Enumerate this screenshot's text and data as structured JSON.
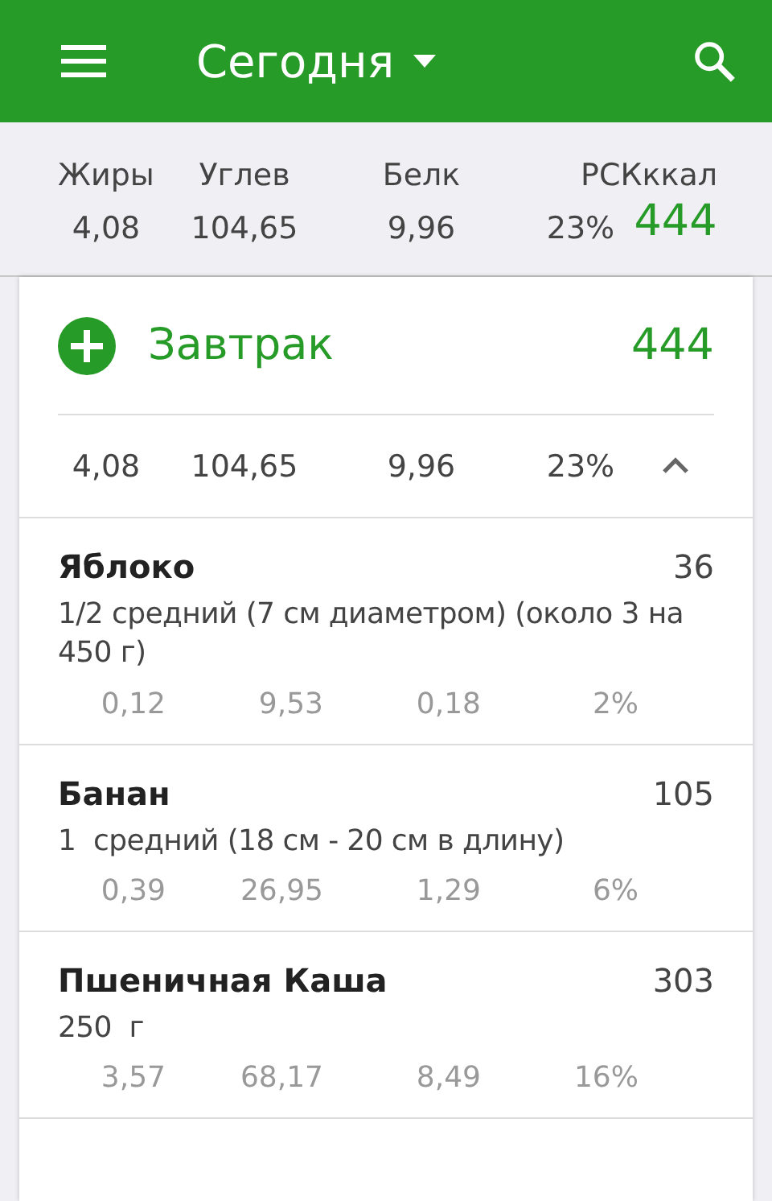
{
  "app_bar": {
    "title": "Сегодня"
  },
  "summary": {
    "labels": [
      "Жиры",
      "Углев",
      "Белк",
      "РСКккал"
    ],
    "values": [
      "4,08",
      "104,65",
      "9,96",
      "23%"
    ],
    "calories": "444"
  },
  "meal": {
    "name": "Завтрак",
    "calories": "444",
    "totals": [
      "4,08",
      "104,65",
      "9,96",
      "23%"
    ],
    "expanded": true,
    "items": [
      {
        "name": "Яблоко",
        "calories": "36",
        "portion": "1/2 средний (7 см диаметром) (около 3 на 450 г)",
        "values": [
          "0,12",
          "9,53",
          "0,18",
          "2%"
        ]
      },
      {
        "name": "Банан",
        "calories": "105",
        "portion": "1  средний (18 см - 20 см в длину)",
        "values": [
          "0,39",
          "26,95",
          "1,29",
          "6%"
        ]
      },
      {
        "name": "Пшеничная Каша",
        "calories": "303",
        "portion": "250  г",
        "values": [
          "3,57",
          "68,17",
          "8,49",
          "16%"
        ]
      }
    ]
  }
}
